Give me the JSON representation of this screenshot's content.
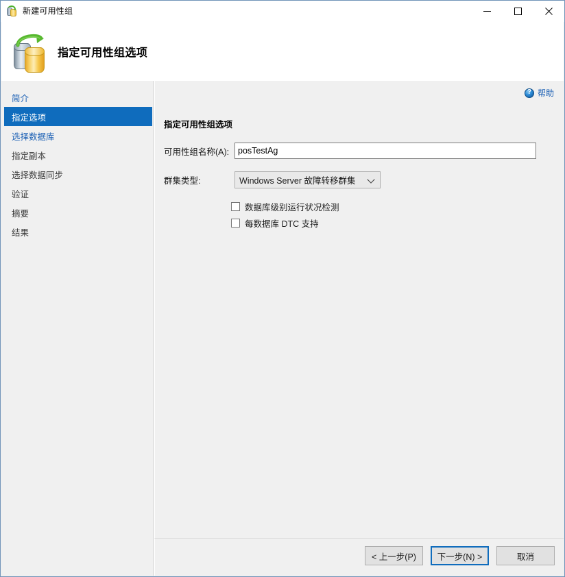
{
  "window": {
    "title": "新建可用性组",
    "icon": "availability-group-icon",
    "controls": {
      "minimize": "minimize-icon",
      "maximize": "maximize-icon",
      "close": "close-icon"
    }
  },
  "header": {
    "title": "指定可用性组选项",
    "icon": "database-replication-icon"
  },
  "sidebar": {
    "items": [
      {
        "label": "简介",
        "state": "link"
      },
      {
        "label": "指定选项",
        "state": "active"
      },
      {
        "label": "选择数据库",
        "state": "link"
      },
      {
        "label": "指定副本",
        "state": "normal"
      },
      {
        "label": "选择数据同步",
        "state": "normal"
      },
      {
        "label": "验证",
        "state": "normal"
      },
      {
        "label": "摘要",
        "state": "normal"
      },
      {
        "label": "结果",
        "state": "normal"
      }
    ]
  },
  "content": {
    "help_label": "帮助",
    "section_title": "指定可用性组选项",
    "name_field": {
      "label": "可用性组名称(A):",
      "value": "posTestAg",
      "placeholder": ""
    },
    "cluster_field": {
      "label": "群集类型:",
      "selected": "Windows Server 故障转移群集"
    },
    "checkboxes": [
      {
        "label": "数据库级别运行状况检测",
        "checked": false
      },
      {
        "label": "每数据库 DTC 支持",
        "checked": false
      }
    ]
  },
  "footer": {
    "back_label": "< 上一步(P)",
    "next_label": "下一步(N) >",
    "cancel_label": "取消"
  },
  "colors": {
    "accent": "#0f6cbd",
    "link": "#1a5fb4",
    "panel": "#f0f0f0",
    "strip": "#0a63b0"
  }
}
